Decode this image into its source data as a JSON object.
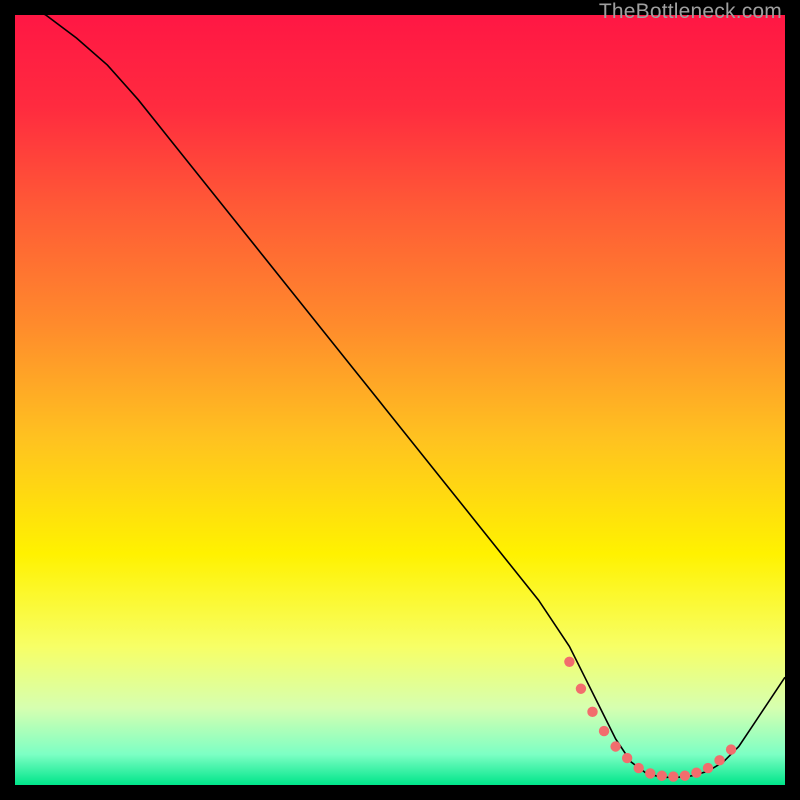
{
  "watermark": "TheBottleneck.com",
  "chart_data": {
    "type": "line",
    "title": "",
    "xlabel": "",
    "ylabel": "",
    "xlim": [
      0,
      100
    ],
    "ylim": [
      0,
      100
    ],
    "background_gradient": {
      "stops": [
        {
          "offset": 0.0,
          "color": "#ff1744"
        },
        {
          "offset": 0.12,
          "color": "#ff2b3f"
        },
        {
          "offset": 0.25,
          "color": "#ff5a36"
        },
        {
          "offset": 0.4,
          "color": "#ff8a2c"
        },
        {
          "offset": 0.55,
          "color": "#ffc220"
        },
        {
          "offset": 0.7,
          "color": "#fff200"
        },
        {
          "offset": 0.82,
          "color": "#f7ff66"
        },
        {
          "offset": 0.9,
          "color": "#d6ffb0"
        },
        {
          "offset": 0.96,
          "color": "#7dffc4"
        },
        {
          "offset": 1.0,
          "color": "#00e58a"
        }
      ]
    },
    "series": [
      {
        "name": "curve",
        "color": "#000000",
        "stroke_width": 1.6,
        "x": [
          0,
          4,
          8,
          12,
          16,
          20,
          24,
          28,
          32,
          36,
          40,
          44,
          48,
          52,
          56,
          60,
          64,
          68,
          72,
          74,
          76,
          78,
          80,
          82,
          84,
          86,
          88,
          90,
          92,
          94,
          96,
          98,
          100
        ],
        "y": [
          102,
          100,
          97,
          93.5,
          89,
          84,
          79,
          74,
          69,
          64,
          59,
          54,
          49,
          44,
          39,
          34,
          29,
          24,
          18,
          14,
          10,
          6,
          3,
          1.5,
          1,
          1,
          1.2,
          1.8,
          3,
          5,
          8,
          11,
          14
        ]
      }
    ],
    "markers": {
      "name": "highlight-dots",
      "color": "#f26d6d",
      "radius": 5.2,
      "x": [
        72,
        73.5,
        75,
        76.5,
        78,
        79.5,
        81,
        82.5,
        84,
        85.5,
        87,
        88.5,
        90,
        91.5,
        93
      ],
      "y": [
        16,
        12.5,
        9.5,
        7,
        5,
        3.5,
        2.2,
        1.5,
        1.2,
        1.1,
        1.2,
        1.6,
        2.2,
        3.2,
        4.6
      ]
    }
  }
}
